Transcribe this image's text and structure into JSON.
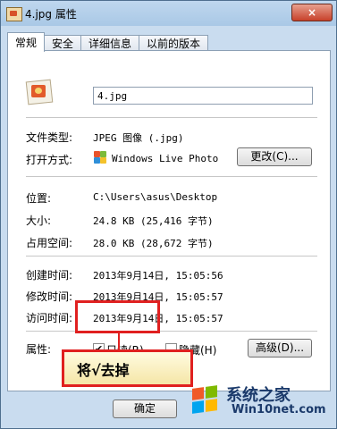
{
  "window": {
    "title": "4.jpg 属性",
    "close_label": "×"
  },
  "tabs": [
    "常规",
    "安全",
    "详细信息",
    "以前的版本"
  ],
  "general": {
    "file_name": "4.jpg",
    "file_type_label": "文件类型:",
    "file_type_value": "JPEG 图像 (.jpg)",
    "open_with_label": "打开方式:",
    "open_with_value": "Windows Live Photo",
    "change_button": "更改(C)...",
    "location_label": "位置:",
    "location_value": "C:\\Users\\asus\\Desktop",
    "size_label": "大小:",
    "size_value": "24.8 KB (25,416 字节)",
    "size_on_disk_label": "占用空间:",
    "size_on_disk_value": "28.0 KB (28,672 字节)",
    "created_label": "创建时间:",
    "created_value": "2013年9月14日, 15:05:56",
    "modified_label": "修改时间:",
    "modified_value": "2013年9月14日, 15:05:57",
    "accessed_label": "访问时间:",
    "accessed_value": "2013年9月14日, 15:05:57",
    "attributes_label": "属性:",
    "readonly_label": "只读(R)",
    "readonly_checked": true,
    "hidden_label": "隐藏(H)",
    "hidden_checked": false,
    "advanced_button": "高级(D)..."
  },
  "footer": {
    "ok_button": "确定"
  },
  "annotation": {
    "text": "将√去掉",
    "color": "#e02020"
  },
  "watermark": {
    "line1": "系统之家",
    "line2": "Win10net.com"
  }
}
